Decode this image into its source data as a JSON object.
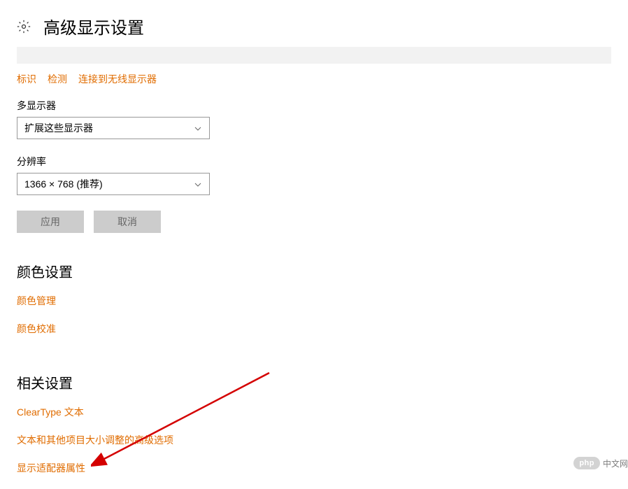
{
  "header": {
    "title": "高级显示设置"
  },
  "links": {
    "identify": "标识",
    "detect": "检测",
    "connect_wireless": "连接到无线显示器"
  },
  "multi_display": {
    "label": "多显示器",
    "selected": "扩展这些显示器"
  },
  "resolution": {
    "label": "分辨率",
    "selected": "1366 × 768 (推荐)"
  },
  "buttons": {
    "apply": "应用",
    "cancel": "取消"
  },
  "color_section": {
    "heading": "颜色设置",
    "color_management": "颜色管理",
    "color_calibration": "颜色校准"
  },
  "related_section": {
    "heading": "相关设置",
    "cleartype": "ClearType 文本",
    "advanced_sizing": "文本和其他项目大小调整的高级选项",
    "adapter_properties": "显示适配器属性"
  },
  "watermark": {
    "badge": "php",
    "text": "中文网"
  }
}
